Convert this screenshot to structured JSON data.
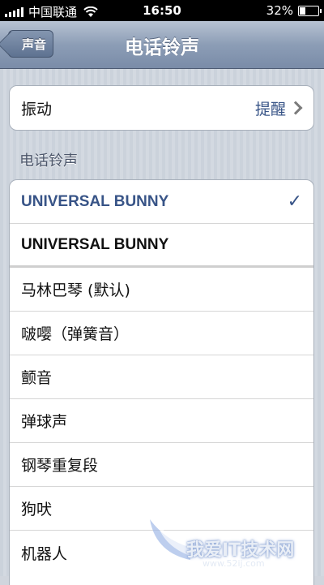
{
  "status_bar": {
    "carrier": "中国联通",
    "time": "16:50",
    "battery_percent": "32%",
    "battery_level": 0.32
  },
  "nav": {
    "back_label": "声音",
    "title": "电话铃声"
  },
  "vibration": {
    "label": "振动",
    "value": "提醒"
  },
  "section_header": "电话铃声",
  "ringtones": [
    {
      "label": "UNIVERSAL BUNNY",
      "selected": true
    },
    {
      "label": "UNIVERSAL BUNNY",
      "selected": false
    },
    {
      "label": "马林巴琴 (默认)",
      "selected": false
    },
    {
      "label": "啵嘤（弹簧音）",
      "selected": false
    },
    {
      "label": "颤音",
      "selected": false
    },
    {
      "label": "弹球声",
      "selected": false
    },
    {
      "label": "钢琴重复段",
      "selected": false
    },
    {
      "label": "狗吠",
      "selected": false
    },
    {
      "label": "机器人",
      "selected": false
    }
  ],
  "check_mark": "✓",
  "watermark": {
    "text": "我爱IT技术网",
    "url": "www.52ij.com"
  },
  "colors": {
    "accent": "#385487",
    "nav_bar": "#8c9db6"
  }
}
